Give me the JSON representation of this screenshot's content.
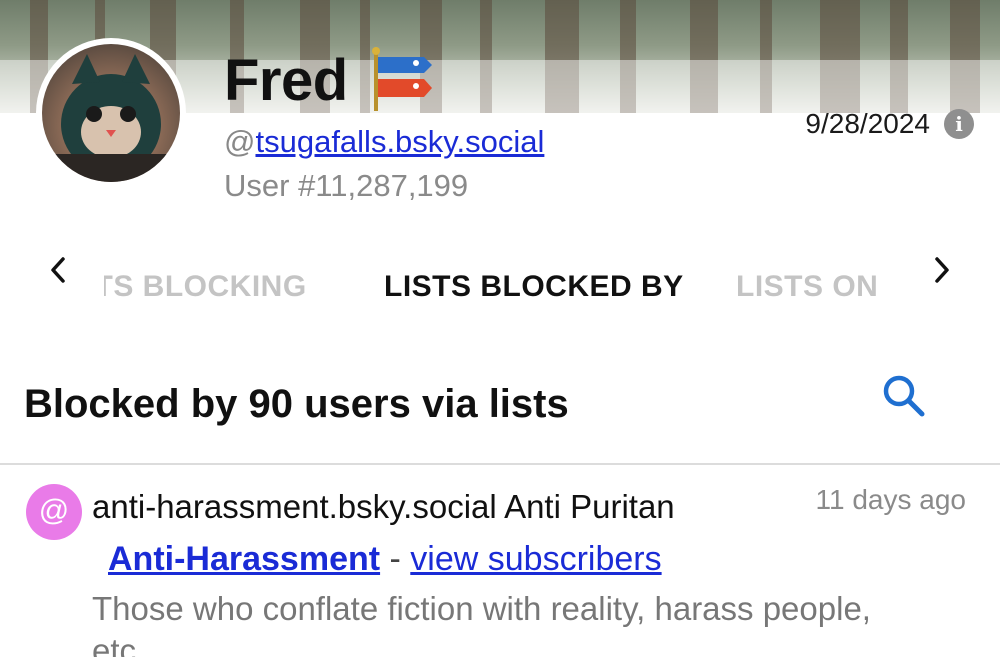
{
  "profile": {
    "display_name": "Fred",
    "handle_prefix": "@",
    "handle": "tsugafalls.bsky.social",
    "user_number": "User #11,287,199",
    "date": "9/28/2024",
    "flag_icon": "carp-streamer-icon",
    "avatar_icon": "plush-cat-avatar"
  },
  "tabs": {
    "prev_icon": "chevron-left-icon",
    "next_icon": "chevron-right-icon",
    "items": [
      {
        "label": "STS BLOCKING",
        "state": "faded"
      },
      {
        "label": "LISTS BLOCKED BY",
        "state": "active"
      },
      {
        "label": "LISTS ON",
        "state": "faded"
      }
    ]
  },
  "section": {
    "title": "Blocked by 90 users via lists",
    "search_icon": "search-icon"
  },
  "list_items": [
    {
      "badge": "@",
      "handle_line": "anti-harassment.bsky.social Anti Puritan",
      "time": "11 days ago",
      "list_name": "Anti-Harassment",
      "separator": " - ",
      "subscribers_link": "view subscribers",
      "description": "Those who conflate fiction with reality, harass people, etc."
    }
  ],
  "colors": {
    "link": "#1a2bd6",
    "badge": "#e97be8",
    "search": "#1f6fd0",
    "muted": "#8a8a8a"
  }
}
